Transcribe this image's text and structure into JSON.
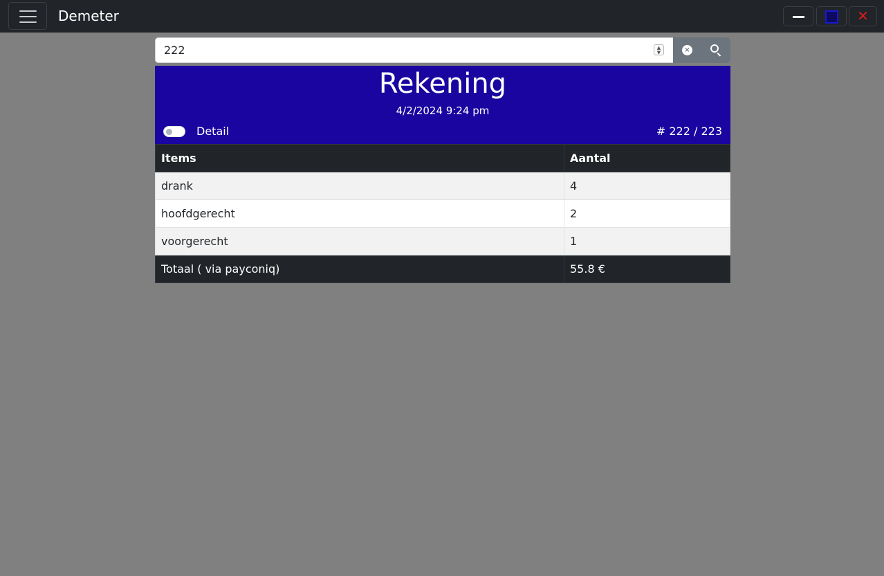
{
  "app": {
    "title": "Demeter"
  },
  "window_controls": {
    "minimize": "minimize-icon",
    "maximize": "maximize-icon",
    "close": "✕"
  },
  "search": {
    "value": "222",
    "placeholder": ""
  },
  "bill": {
    "title": "Rekening",
    "datetime": "4/2/2024 9:24 pm",
    "detail_label": "Detail",
    "detail_on": false,
    "counter": "# 222 / 223",
    "header_color": "#1a05a0"
  },
  "table": {
    "columns": [
      "Items",
      "Aantal"
    ],
    "rows": [
      {
        "item": "drank",
        "qty": "4"
      },
      {
        "item": "hoofdgerecht",
        "qty": "2"
      },
      {
        "item": "voorgerecht",
        "qty": "1"
      }
    ],
    "total": {
      "label": "Totaal ( via payconiq)",
      "value": "55.8 €"
    }
  }
}
